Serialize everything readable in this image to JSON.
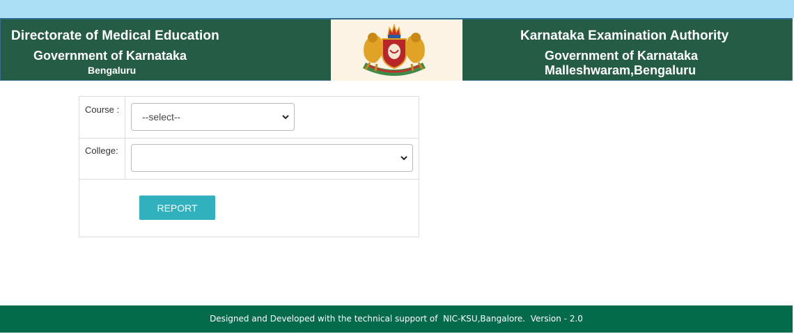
{
  "header": {
    "left": {
      "line1": "Directorate of Medical Education",
      "line2": "Government of Karnataka",
      "line3": "Bengaluru"
    },
    "right": {
      "line1": "Karnataka Examination Authority",
      "line2": "Government of Karnataka",
      "line3": "Malleshwaram,Bengaluru"
    },
    "emblem_icon": "karnataka-state-emblem-icon"
  },
  "form": {
    "course_label": "Course :",
    "course_selected": "--select--",
    "college_label": "College:",
    "college_selected": "",
    "report_button": "REPORT"
  },
  "footer": {
    "text": "Designed and Developed with the technical support of  NIC-KSU,Bangalore.  Version - 2.0"
  },
  "colors": {
    "top_strip": "#abdff6",
    "banner_green": "#245c45",
    "emblem_background": "#fdf3e4",
    "button_teal": "#31b0be",
    "footer_green": "#046b4a"
  }
}
